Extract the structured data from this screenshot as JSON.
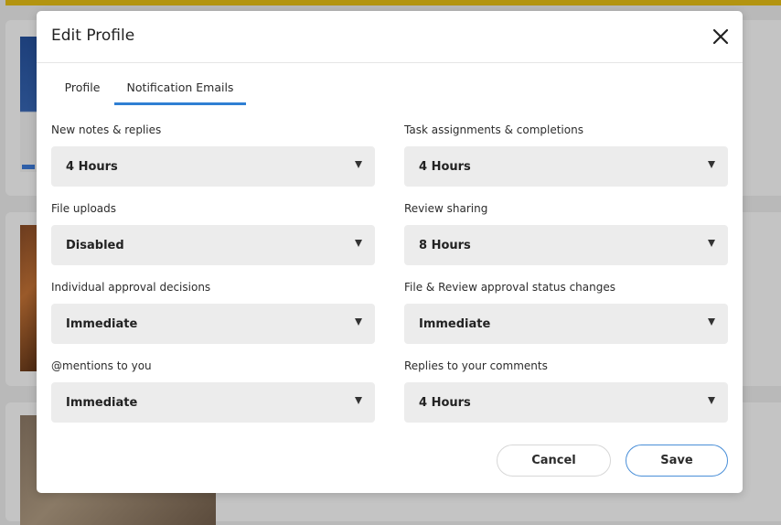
{
  "modal": {
    "title": "Edit Profile",
    "close_icon": "close-icon"
  },
  "tabs": [
    {
      "label": "Profile",
      "active": false
    },
    {
      "label": "Notification Emails",
      "active": true
    }
  ],
  "fields": [
    {
      "label": "New notes & replies",
      "value": "4 Hours"
    },
    {
      "label": "Task assignments & completions",
      "value": "4 Hours"
    },
    {
      "label": "File uploads",
      "value": "Disabled"
    },
    {
      "label": "Review sharing",
      "value": "8 Hours"
    },
    {
      "label": "Individual approval decisions",
      "value": "Immediate"
    },
    {
      "label": "File & Review approval status changes",
      "value": "Immediate"
    },
    {
      "label": "@mentions to you",
      "value": "Immediate"
    },
    {
      "label": "Replies to your comments",
      "value": "4 Hours"
    }
  ],
  "buttons": {
    "cancel": "Cancel",
    "save": "Save"
  },
  "colors": {
    "accent": "#2f7fd3",
    "select_bg": "#ececec"
  }
}
